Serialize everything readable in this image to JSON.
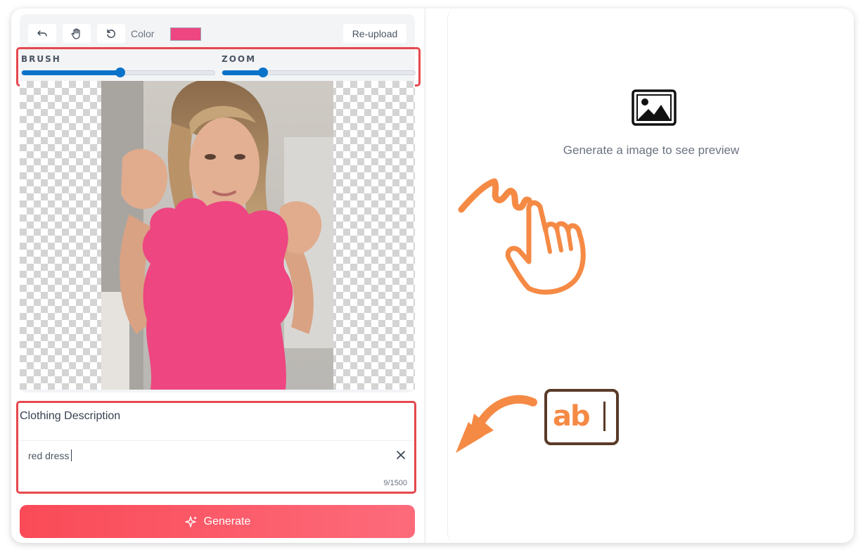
{
  "toolbar": {
    "undo_icon": "undo-icon",
    "pan_icon": "hand-icon",
    "reset_icon": "reset-icon",
    "color_label": "Color",
    "color_value": "#ee4681",
    "reupload_label": "Re-upload"
  },
  "sliders": {
    "brush": {
      "label": "BRUSH",
      "value": 0.51
    },
    "zoom": {
      "label": "ZOOM",
      "value": 0.21
    }
  },
  "canvas": {
    "image_description_visible": false,
    "mask_color": "#ee4681"
  },
  "description": {
    "title": "Clothing Description",
    "value": "red dress",
    "char_count": "9/1500"
  },
  "generate": {
    "label": "Generate",
    "icon": "sparkle-icon"
  },
  "preview": {
    "icon": "image-icon",
    "text": "Generate a image to see preview"
  },
  "illustrations": {
    "hand": "tap-hand-icon",
    "arrow": "curved-arrow-icon",
    "text_field": "text-field-icon",
    "text_field_letters": "ab",
    "accent": "#f58a45"
  }
}
